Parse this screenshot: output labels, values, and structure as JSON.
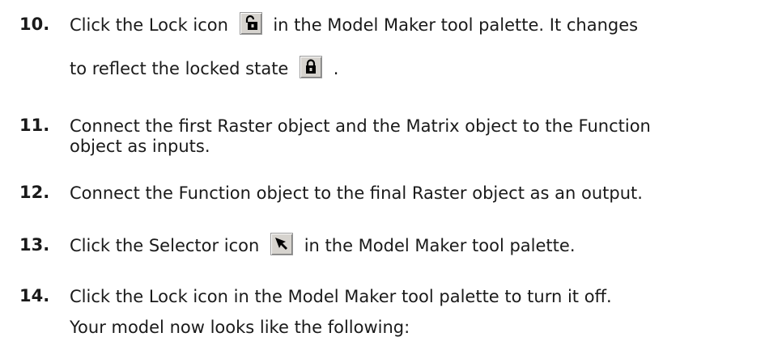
{
  "steps": [
    {
      "number": "10.",
      "line1_before": "Click the Lock icon",
      "line1_icon": "unlocked-lock-icon",
      "line1_after": "in the Model Maker tool palette. It changes",
      "line2_before": "to reflect the locked state",
      "line2_icon": "locked-lock-icon",
      "line2_after": "."
    },
    {
      "number": "11.",
      "line1": "Connect the first Raster object and the Matrix object to the Function",
      "line2": "object as inputs."
    },
    {
      "number": "12.",
      "line1": "Connect the Function object to the final Raster object as an output."
    },
    {
      "number": "13.",
      "line1_before": "Click the Selector icon",
      "line1_icon": "selector-arrow-icon",
      "line1_after": "in the Model Maker tool palette."
    },
    {
      "number": "14.",
      "line1": "Click the Lock icon in the Model Maker tool palette to turn it off.",
      "line2": "Your model now looks like the following:"
    }
  ]
}
